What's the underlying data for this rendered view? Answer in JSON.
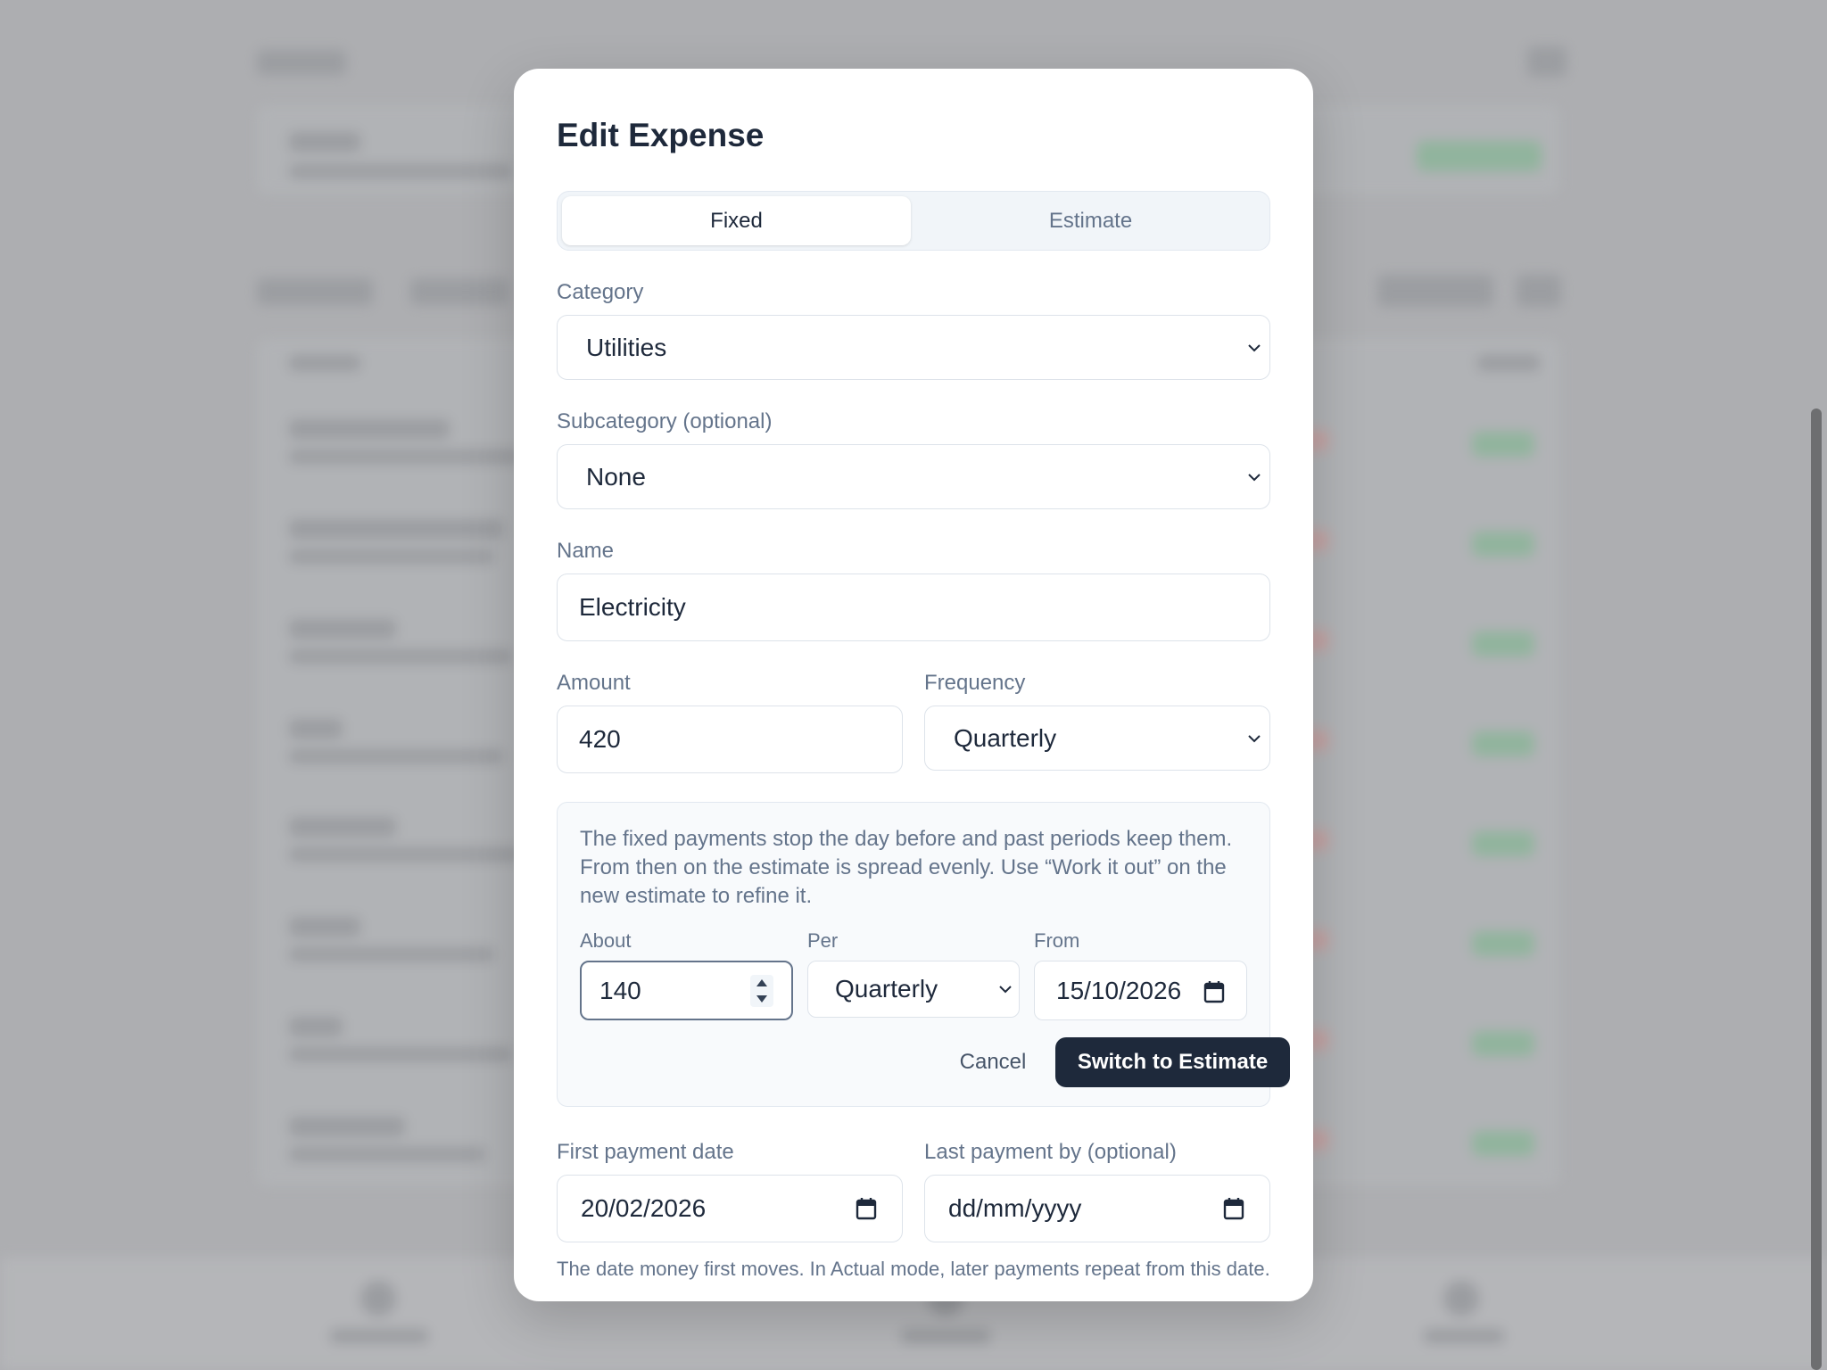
{
  "modal": {
    "title": "Edit Expense",
    "mode_tabs": [
      {
        "label": "Fixed",
        "selected": true
      },
      {
        "label": "Estimate",
        "selected": false
      }
    ],
    "category": {
      "label": "Category",
      "value": "Utilities"
    },
    "subcategory": {
      "label": "Subcategory (optional)",
      "value": "None"
    },
    "name": {
      "label": "Name",
      "value": "Electricity"
    },
    "amount": {
      "label": "Amount",
      "value": "420"
    },
    "frequency": {
      "label": "Frequency",
      "value": "Quarterly"
    },
    "switch_panel": {
      "text": "The fixed payments stop the day before and past periods keep them. From then on the estimate is spread evenly. Use “Work it out” on the new estimate to refine it.",
      "about": {
        "label": "About",
        "value": "140"
      },
      "per": {
        "label": "Per",
        "value": "Quarterly"
      },
      "from": {
        "label": "From",
        "value": "15/10/2026"
      },
      "cancel_label": "Cancel",
      "confirm_label": "Switch to Estimate"
    },
    "first_payment": {
      "label": "First payment date",
      "value": "20/02/2026"
    },
    "last_payment": {
      "label": "Last payment by (optional)",
      "placeholder": "dd/mm/yyyy"
    },
    "hint": "The date money first moves. In Actual mode, later payments repeat from this date."
  },
  "colors": {
    "primary": "#1e293b",
    "muted_text": "#64748b",
    "border": "#dde3ea",
    "panel_bg": "#f8fafc",
    "overlay": "#adaeb1"
  }
}
